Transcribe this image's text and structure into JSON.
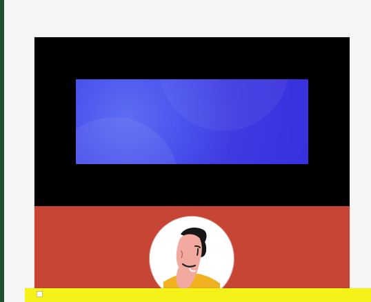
{
  "page": {
    "colors": {
      "background": "#f5f5f5",
      "leftEdge": "#1f4f2c",
      "hero": "#000000",
      "heroPanel": "#3f3ae0",
      "profileBand": "#c64535",
      "avatarRing": "#ffffff",
      "bottomBar": "#f5f21a"
    }
  },
  "icons": {
    "avatar": "person-avatar-icon",
    "bottomCheckbox": "checkbox-icon"
  }
}
